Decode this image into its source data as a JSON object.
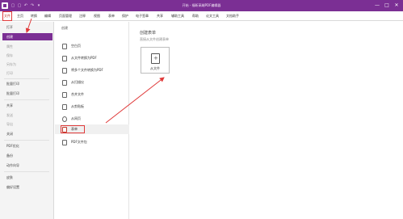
{
  "window": {
    "title": "开始 - 福昕高端PDF编辑器",
    "minimize": "—",
    "maximize": "□",
    "close": "✕"
  },
  "quick_access": [
    "▢",
    "▢",
    "↶",
    "↷",
    "▾"
  ],
  "menubar": {
    "items": [
      "文件",
      "主页",
      "转换",
      "编辑",
      "页面管理",
      "注释",
      "视图",
      "表单",
      "保护",
      "电子签章",
      "共享",
      "辅助工具",
      "帮助",
      "论文工具",
      "文档助手"
    ]
  },
  "sidebar": {
    "items": [
      {
        "label": "打开",
        "state": "normal"
      },
      {
        "label": "创建",
        "state": "active"
      },
      {
        "label": "属性",
        "state": "dim"
      },
      {
        "label": "保存",
        "state": "dim"
      },
      {
        "label": "另存为",
        "state": "dim"
      },
      {
        "label": "打印",
        "state": "dim"
      },
      {
        "label": "批量打印",
        "state": "normal"
      },
      {
        "label": "批量打印",
        "state": "normal"
      },
      {
        "label": "共享",
        "state": "normal"
      },
      {
        "label": "发送",
        "state": "dim"
      },
      {
        "label": "导出",
        "state": "dim"
      },
      {
        "label": "关闭",
        "state": "normal"
      },
      {
        "label": "PDF优化",
        "state": "normal"
      },
      {
        "label": "备份",
        "state": "normal"
      },
      {
        "label": "动作向导",
        "state": "normal"
      },
      {
        "label": "皮肤",
        "state": "normal"
      },
      {
        "label": "偏好设置",
        "state": "normal"
      }
    ]
  },
  "middle": {
    "heading": "创建",
    "options": [
      {
        "label": "空白页"
      },
      {
        "label": "从文件转换为PDF"
      },
      {
        "label": "将多个文件转换为PDF"
      },
      {
        "label": "从扫描仪"
      },
      {
        "label": "合并文件"
      },
      {
        "label": "从剪贴板"
      },
      {
        "label": "从网页"
      },
      {
        "label": "表单"
      },
      {
        "label": "PDF文件包"
      }
    ]
  },
  "right": {
    "title": "创建表单",
    "subtitle": "直接从文件创建表单",
    "card_label": "从文件"
  }
}
